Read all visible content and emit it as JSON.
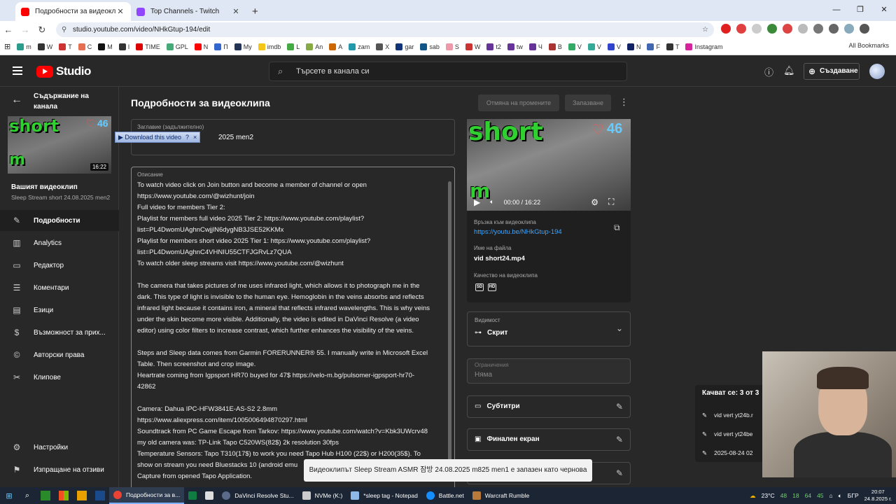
{
  "browser": {
    "tabs": [
      {
        "title": "Подробности за видеоклипа",
        "color": "#ff0000"
      },
      {
        "title": "Top Channels - Twitch",
        "color": "#9146ff"
      }
    ],
    "new_tab": "+",
    "url": "studio.youtube.com/video/NHkGtup-194/edit",
    "bookmarks": [
      "m",
      "W",
      "T",
      "C",
      "M",
      "I",
      "TIME",
      "GPL",
      "N",
      "П",
      "My",
      "imdb",
      "L",
      "An",
      "A",
      "zam",
      "X",
      "gar",
      "sab",
      "S",
      "W",
      "t2",
      "tw",
      "Ч",
      "B",
      "V",
      "V",
      "V",
      "N",
      "F",
      "T",
      "Instagram"
    ],
    "all_bookmarks": "All Bookmarks"
  },
  "header": {
    "logo_text": "Studio",
    "search_placeholder": "Търсете в канала си",
    "create_label": "Създаване"
  },
  "sidebar": {
    "channel_label": "Съдържание на канала",
    "thumb_duration": "16:22",
    "thumb_sticker_top": "short",
    "thumb_sticker_bottom": "m",
    "thumb_count": "46",
    "your_video": "Вашият видеоклип",
    "video_title": "Sleep Stream short 24.08.2025 men2",
    "items": [
      {
        "label": "Подробности",
        "icon": "✎",
        "active": true
      },
      {
        "label": "Analytics",
        "icon": "▥",
        "active": false
      },
      {
        "label": "Редактор",
        "icon": "▭",
        "active": false
      },
      {
        "label": "Коментари",
        "icon": "☰",
        "active": false
      },
      {
        "label": "Езици",
        "icon": "▤",
        "active": false
      },
      {
        "label": "Възможност за прих...",
        "icon": "$",
        "active": false
      },
      {
        "label": "Авторски права",
        "icon": "©",
        "active": false
      },
      {
        "label": "Клипове",
        "icon": "✂",
        "active": false
      }
    ],
    "settings": "Настройки",
    "feedback": "Изпращане на отзиви"
  },
  "main": {
    "page_title": "Подробности за видеоклипа",
    "undo_label": "Отмяна на промените",
    "save_label": "Запазване",
    "title_label": "Заглавие (задължително)",
    "title_value": "2025 men2",
    "download_bar": "▶ Download this video",
    "download_help": "?",
    "download_close": "×",
    "description_label": "Описание",
    "description": "To watch video click on Join button and become a member of channel or open\nhttps://www.youtube.com/@wizhunt/join\nFull video for members Tier 2:\nPlaylist for members full video 2025 Tier 2: https://www.youtube.com/playlist?\nlist=PL4DwomUAghnCwjjlN6dygNB3JSE52KKMx\nPlaylist for members short video 2025 Tier 1: https://www.youtube.com/playlist?\nlist=PL4DwomUAghnC4VHNIU55CTFJGRvLz7QUA\nTo watch older sleep streams visit https://www.youtube.com/@wizhunt\n\nThe camera that takes pictures of me uses infrared light, which allows it to photograph me in the\ndark. This type of light is invisible to the human eye. Hemoglobin in the veins absorbs and reflects\ninfrared light because it contains iron, a mineral that reflects infrared wavelengths. This is why veins\nunder the skin become more visible. Additionally, the video is edited in DaVinci Resolve (a video\neditor) using color filters to increase contrast, which further enhances the visibility of the veins.\n\nSteps and Sleep data comes from Garmin FORERUNNER® 55. I manually write in Microsoft Excel\nTable. Then screenshot and crop image.\nHeartrate coming from Igpsport HR70 buyed for 47$ https://velo-m.bg/pulsomer-igpsport-hr70-\n42862\n\nCamera: Dahua IPC-HFW3841E-AS-S2 2.8mm\nhttps://www.aliexpress.com/item/1005006494870297.html\nSoundtrack from PC Game Escape from Tarkov: https://www.youtube.com/watch?v=Kbk3UWcrv48\nmy old camera was: TP-Link Tapo C520WS(82$) 2k resolution 30fps\nTemperature Sensors: Tapo T310(17$) to work you need Tapo Hub H100 (22$) or H200(35$). To\nshow on stream you need Bluestacks 10 (android emu\nCapture from opened Tapo Application."
  },
  "preview": {
    "sticker_top": "short",
    "sticker_bottom": "m",
    "count": "46",
    "time": "00:00 / 16:22",
    "link_label": "Връзка към видеоклипа",
    "link": "https://youtu.be/NHkGtup-194",
    "filename_label": "Име на файла",
    "filename": "vid short24.mp4",
    "quality_label": "Качество на видеоклипа",
    "quality_badges": [
      "SD",
      "HD"
    ]
  },
  "right": {
    "visibility_label": "Видимост",
    "visibility_value": "Скрит",
    "restrictions_label": "Ограничения",
    "restrictions_value": "Няма",
    "subtitles": "Субтитри",
    "end_screen": "Финален екран"
  },
  "upload_queue": {
    "title": "Качват се: 3 от 3",
    "items": [
      "vid vert yt24b.r",
      "vid vert yt24be",
      "2025-08-24 02"
    ]
  },
  "toast": "Видеоклипът Sleep Stream ASMR 잠방 24.08.2025 m825 men1 е запазен като чернова",
  "taskbar": {
    "apps": [
      {
        "label": "Подробности за в...",
        "color": "#ea4335",
        "active": true
      },
      {
        "label": "",
        "color": "#107c41",
        "active": false
      },
      {
        "label": "",
        "color": "#dddddd",
        "active": false
      },
      {
        "label": "DaVinci Resolve Stu...",
        "color": "#5a6a8a",
        "active": false
      },
      {
        "label": "NVMe (K:)",
        "color": "#cccccc",
        "active": false
      },
      {
        "label": "*sleep tag - Notepad",
        "color": "#8fb8e8",
        "active": false
      },
      {
        "label": "Battle.net",
        "color": "#148eff",
        "active": false
      },
      {
        "label": "Warcraft Rumble",
        "color": "#b87a3a",
        "active": false
      }
    ],
    "weather": "23°C",
    "tray_nums": [
      "48",
      "18",
      "64",
      "45"
    ],
    "lang": "БГР",
    "time": "20:07",
    "date": "24.8.2025 г."
  }
}
